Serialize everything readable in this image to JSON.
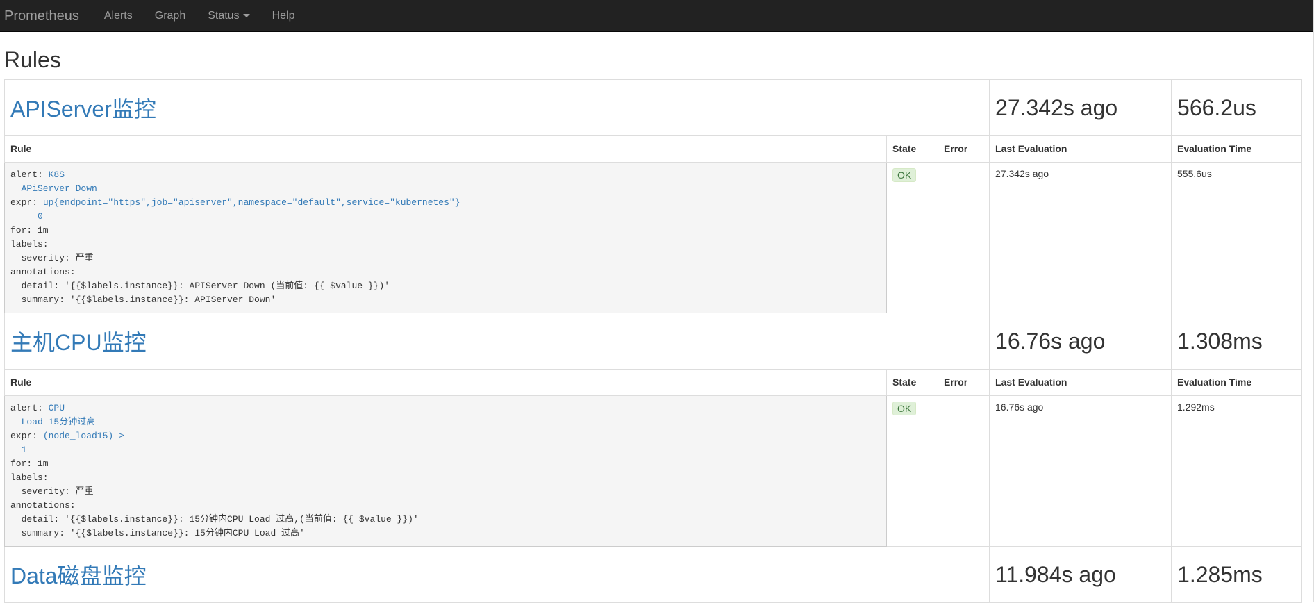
{
  "navbar": {
    "brand": "Prometheus",
    "items": [
      {
        "label": "Alerts"
      },
      {
        "label": "Graph"
      },
      {
        "label": "Status"
      },
      {
        "label": "Help"
      }
    ]
  },
  "page": {
    "title": "Rules"
  },
  "columns": {
    "rule": "Rule",
    "state": "State",
    "error": "Error",
    "last_evaluation": "Last Evaluation",
    "evaluation_time": "Evaluation Time"
  },
  "groups": [
    {
      "name": "APIServer监控",
      "last_evaluation": "27.342s ago",
      "evaluation_time": "566.2us",
      "rule": {
        "alert_key": "alert: ",
        "alert_name_1": "K8S",
        "alert_name_2": "  APiServer Down",
        "expr_key": "expr: ",
        "expr_1": "up{endpoint=\"https\",job=\"apiserver\",namespace=\"default\",service=\"kubernetes\"}",
        "expr_2": "  == 0",
        "for": "for: 1m",
        "labels_key": "labels:",
        "severity": "  severity: 严重",
        "annotations_key": "annotations:",
        "detail": "  detail: '{{$labels.instance}}: APIServer Down (当前值: {{ $value }})'",
        "summary": "  summary: '{{$labels.instance}}: APIServer Down'",
        "state": "OK",
        "error": "",
        "last_evaluation": "27.342s ago",
        "evaluation_time": "555.6us"
      }
    },
    {
      "name": "主机CPU监控",
      "last_evaluation": "16.76s ago",
      "evaluation_time": "1.308ms",
      "rule": {
        "alert_key": "alert: ",
        "alert_name_1": "CPU",
        "alert_name_2": "  Load 15分钟过高",
        "expr_key": "expr: ",
        "expr_1": "(node_load15) >",
        "expr_2": "  1",
        "for": "for: 1m",
        "labels_key": "labels:",
        "severity": "  severity: 严重",
        "annotations_key": "annotations:",
        "detail": "  detail: '{{$labels.instance}}: 15分钟内CPU Load 过高,(当前值: {{ $value }})'",
        "summary": "  summary: '{{$labels.instance}}: 15分钟内CPU Load 过高'",
        "state": "OK",
        "error": "",
        "last_evaluation": "16.76s ago",
        "evaluation_time": "1.292ms"
      }
    },
    {
      "name": "Data磁盘监控",
      "last_evaluation": "11.984s ago",
      "evaluation_time": "1.285ms"
    }
  ]
}
